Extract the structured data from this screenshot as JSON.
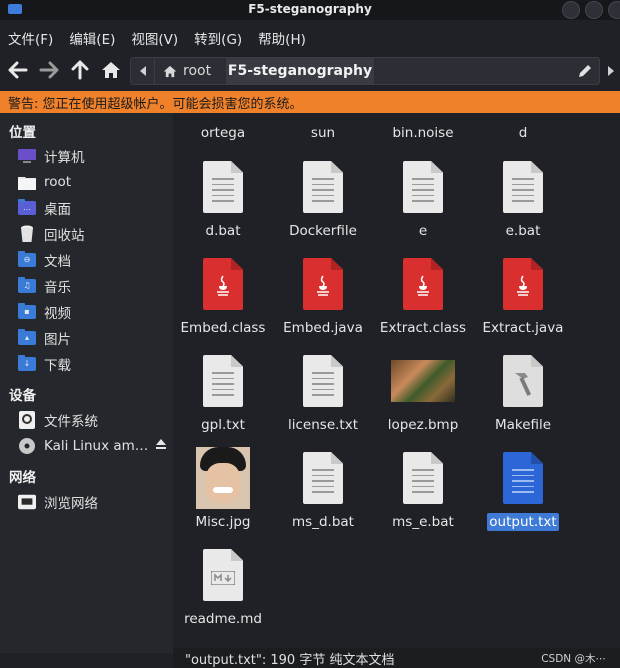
{
  "window": {
    "title": "F5-steganography"
  },
  "menu": [
    "文件(F)",
    "编辑(E)",
    "视图(V)",
    "转到(G)",
    "帮助(H)"
  ],
  "path": {
    "root": "root",
    "current": "F5-steganography"
  },
  "warning": "警告: 您正在使用超级帐户。可能会损害您的系统。",
  "sidebar": {
    "places_header": "位置",
    "places": [
      {
        "label": "计算机",
        "icon": "computer-icon"
      },
      {
        "label": "root",
        "icon": "folder-icon"
      },
      {
        "label": "桌面",
        "icon": "desktop-folder-icon"
      },
      {
        "label": "回收站",
        "icon": "trash-icon"
      },
      {
        "label": "文档",
        "icon": "documents-folder-icon"
      },
      {
        "label": "音乐",
        "icon": "music-folder-icon"
      },
      {
        "label": "视频",
        "icon": "videos-folder-icon"
      },
      {
        "label": "图片",
        "icon": "pictures-folder-icon"
      },
      {
        "label": "下载",
        "icon": "downloads-folder-icon"
      }
    ],
    "devices_header": "设备",
    "devices": [
      {
        "label": "文件系统",
        "icon": "filesystem-icon"
      },
      {
        "label": "Kali Linux am…",
        "icon": "optical-disc-icon"
      }
    ],
    "network_header": "网络",
    "network": [
      {
        "label": "浏览网络",
        "icon": "network-icon"
      }
    ]
  },
  "files": [
    {
      "name": "ortega",
      "kind": "partial"
    },
    {
      "name": "sun",
      "kind": "partial"
    },
    {
      "name": "bin.noise",
      "kind": "partial"
    },
    {
      "name": "d",
      "kind": "partial"
    },
    {
      "name": "d.bat",
      "kind": "text"
    },
    {
      "name": "Dockerfile",
      "kind": "text"
    },
    {
      "name": "e",
      "kind": "text"
    },
    {
      "name": "e.bat",
      "kind": "text"
    },
    {
      "name": "Embed.class",
      "kind": "java"
    },
    {
      "name": "Embed.java",
      "kind": "java"
    },
    {
      "name": "Extract.class",
      "kind": "java"
    },
    {
      "name": "Extract.java",
      "kind": "java"
    },
    {
      "name": "gpl.txt",
      "kind": "text"
    },
    {
      "name": "license.txt",
      "kind": "text"
    },
    {
      "name": "lopez.bmp",
      "kind": "image"
    },
    {
      "name": "Makefile",
      "kind": "makefile"
    },
    {
      "name": "Misc.jpg",
      "kind": "photo"
    },
    {
      "name": "ms_d.bat",
      "kind": "text"
    },
    {
      "name": "ms_e.bat",
      "kind": "text"
    },
    {
      "name": "output.txt",
      "kind": "text-selected"
    },
    {
      "name": "readme.md",
      "kind": "markdown"
    }
  ],
  "status": "\"output.txt\": 190 字节 纯文本文档",
  "watermark": "CSDN @木⋯",
  "colors": {
    "accent": "#3e7ad6",
    "warning": "#f0812b",
    "java": "#d9302f"
  }
}
